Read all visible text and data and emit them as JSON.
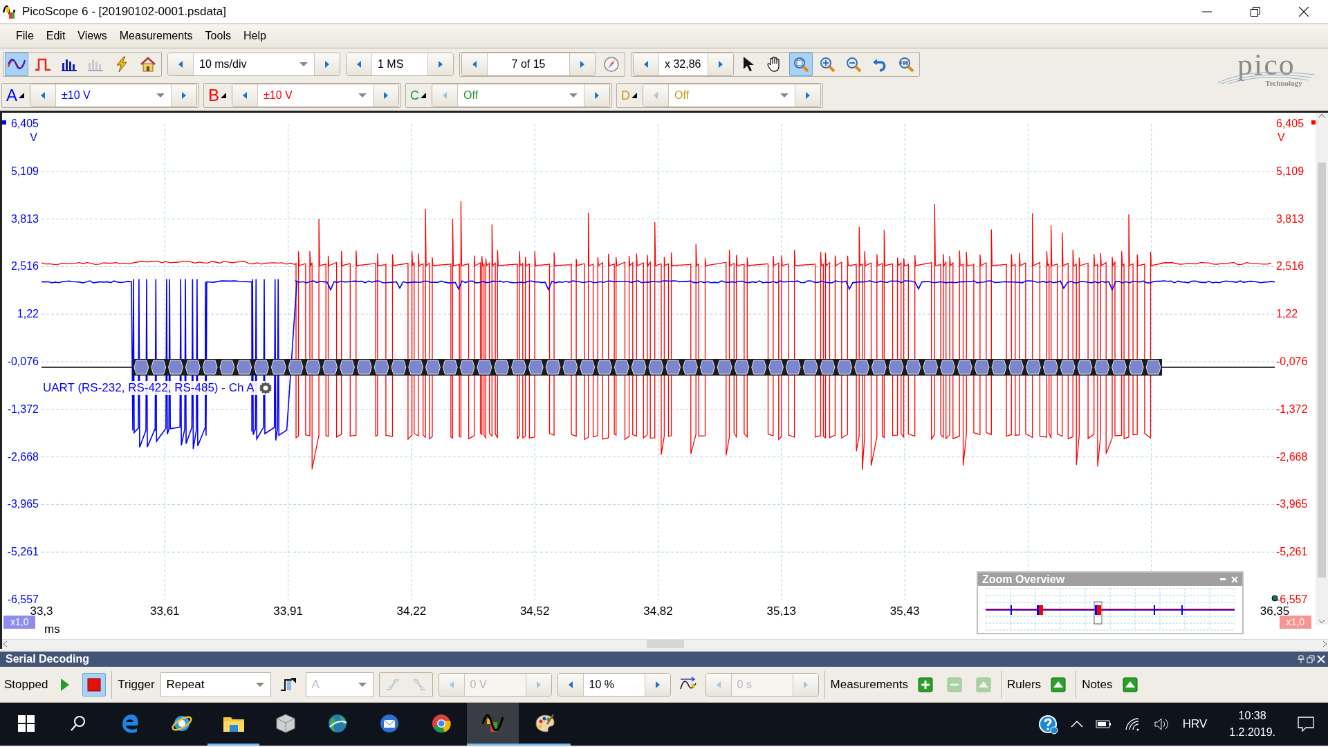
{
  "window": {
    "title": "PicoScope 6 - [20190102-0001.psdata]"
  },
  "menu": [
    "File",
    "Edit",
    "Views",
    "Measurements",
    "Tools",
    "Help"
  ],
  "toolbar": {
    "view_modes": [
      {
        "kind": "scope",
        "selected": true,
        "disabled": false
      },
      {
        "kind": "persistence",
        "selected": false,
        "disabled": false
      },
      {
        "kind": "spectrum",
        "selected": false,
        "disabled": false
      },
      {
        "kind": "spectrum",
        "selected": false,
        "disabled": true
      }
    ],
    "actions": [
      {
        "kind": "auto_setup"
      },
      {
        "kind": "default_setup"
      }
    ],
    "timebase": "10 ms/div",
    "samples": "1 MS",
    "buffer": "7 of 15",
    "zoom_factor": "x 32,86",
    "tools": [
      {
        "kind": "pointer",
        "selected": false
      },
      {
        "kind": "hand",
        "selected": false
      },
      {
        "kind": "zoom_region",
        "selected": true
      },
      {
        "kind": "zoom_in",
        "selected": false
      },
      {
        "kind": "zoom_out",
        "selected": false
      },
      {
        "kind": "undo_zoom",
        "selected": false
      },
      {
        "kind": "zoom_full",
        "selected": false
      }
    ]
  },
  "logo": {
    "name": "pico",
    "tagline": "Technology"
  },
  "channels": [
    {
      "letter": "A",
      "range": "±10 V",
      "color": "#0000ff",
      "enabled": true
    },
    {
      "letter": "B",
      "range": "±10 V",
      "color": "#ff0000",
      "enabled": true
    },
    {
      "letter": "C",
      "range": "Off",
      "color": "#1a9a2a",
      "enabled": false
    },
    {
      "letter": "D",
      "range": "Off",
      "color": "#c89a10",
      "enabled": false
    }
  ],
  "scope": {
    "left_axis": {
      "unit": "V",
      "ticks": [
        "6,405",
        "5,109",
        "3,813",
        "2,516",
        "1,22",
        "-0,076",
        "-1,372",
        "-2,668",
        "-3,965",
        "-5,261",
        "-6,557"
      ],
      "scale": "x1,0"
    },
    "right_axis": {
      "unit": "V",
      "ticks": [
        "6,405",
        "5,109",
        "3,813",
        "2,516",
        "1,22",
        "-0,076",
        "-1,372",
        "-2,668",
        "-3,965",
        "-5,261",
        "-6,557"
      ],
      "scale": "x1,0"
    },
    "x_axis": {
      "unit": "ms",
      "ticks": [
        "33,3",
        "33,61",
        "33,91",
        "34,22",
        "34,52",
        "34,82",
        "35,13",
        "35,43"
      ],
      "end_tick": "36,35"
    },
    "decoder": {
      "label": "UART (RS-232, RS-422, RS-485) - Ch A"
    },
    "zoom_overview": {
      "title": "Zoom Overview"
    }
  },
  "serial_decoding": {
    "title": "Serial Decoding"
  },
  "bottom_toolbar": {
    "status": "Stopped",
    "run_buttons": [
      {
        "kind": "run",
        "selected": false
      },
      {
        "kind": "stop",
        "selected": true
      }
    ],
    "trigger_label": "Trigger",
    "trigger_mode": "Repeat",
    "trigger_source": {
      "value": "A",
      "disabled": true
    },
    "threshold": {
      "value": "0 V",
      "disabled": true
    },
    "pretrigger": {
      "value": "10 %",
      "disabled": false
    },
    "delay": {
      "value": "0 s",
      "disabled": true
    },
    "panels": [
      {
        "label": "Measurements",
        "buttons": [
          {
            "kind": "add",
            "disabled": false
          },
          {
            "kind": "remove",
            "disabled": true
          },
          {
            "kind": "edit",
            "disabled": true
          }
        ]
      },
      {
        "label": "Rulers",
        "buttons": [
          {
            "kind": "edit",
            "disabled": false
          }
        ]
      },
      {
        "label": "Notes",
        "buttons": [
          {
            "kind": "edit",
            "disabled": false
          }
        ]
      }
    ]
  },
  "taskbar": {
    "apps": [
      {
        "kind": "edge",
        "running": false,
        "active": false
      },
      {
        "kind": "ie",
        "running": false,
        "active": false
      },
      {
        "kind": "folder",
        "running": true,
        "active": false
      },
      {
        "kind": "cube",
        "running": false,
        "active": false
      },
      {
        "kind": "globe",
        "running": false,
        "active": false
      },
      {
        "kind": "mail",
        "running": false,
        "active": false
      },
      {
        "kind": "chrome",
        "running": false,
        "active": false
      },
      {
        "kind": "scope",
        "running": true,
        "active": true
      },
      {
        "kind": "paint",
        "running": true,
        "active": false
      }
    ],
    "language": "HRV",
    "time": "10:38",
    "date": "1.2.2019."
  }
}
